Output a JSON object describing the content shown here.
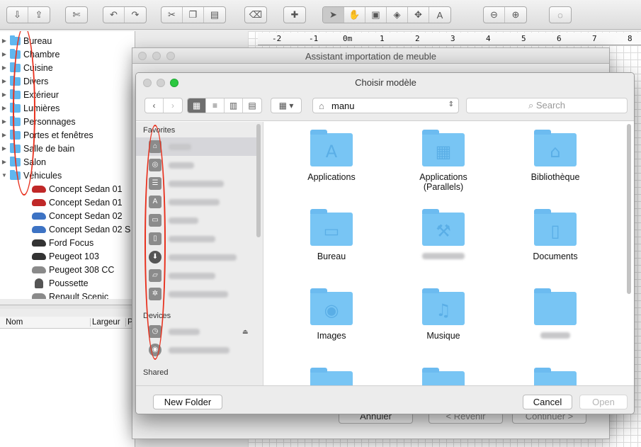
{
  "toolbar": {
    "icons": [
      "import-furniture-icon",
      "import-library-icon",
      "preferences-icon",
      "undo-icon",
      "redo-icon",
      "cut-icon",
      "copy-icon",
      "paste-icon",
      "delete-icon",
      "add-furniture-icon",
      "select-icon",
      "pan-icon",
      "create-walls-icon",
      "create-rooms-icon",
      "create-dimensions-icon",
      "create-labels-icon",
      "zoom-out-icon",
      "zoom-in-icon",
      "help-icon"
    ]
  },
  "catalog": {
    "categories": [
      "Bureau",
      "Chambre",
      "Cuisine",
      "Divers",
      "Extérieur",
      "Lumières",
      "Personnages",
      "Portes et fenêtres",
      "Salle de bain",
      "Salon",
      "Véhicules"
    ],
    "vehicles": [
      "Concept Sedan 01",
      "Concept Sedan 01",
      "Concept Sedan 02",
      "Concept Sedan 02 S",
      "Ford Focus",
      "Peugeot 103",
      "Peugeot 308 CC",
      "Poussette",
      "Renault Scenic"
    ]
  },
  "furniture_list": {
    "columns": [
      "Nom",
      "Largeur",
      "P"
    ]
  },
  "ruler": {
    "ticks": [
      "-2",
      "-1",
      "0m",
      "1",
      "2",
      "3",
      "4",
      "5",
      "6",
      "7",
      "8"
    ]
  },
  "assistant": {
    "title": "Assistant importation de meuble",
    "cancel": "Annuler",
    "back": "< Revenir",
    "next": "Continuer >"
  },
  "chooser": {
    "title": "Choisir modèle",
    "path": "manu",
    "search_placeholder": "Search",
    "sidebar": {
      "favorites_header": "Favorites",
      "devices_header": "Devices",
      "shared_header": "Shared",
      "favorite_icons": [
        "home-icon",
        "airdrop-icon",
        "all-files-icon",
        "applications-icon",
        "desktop-icon",
        "documents-icon",
        "downloads-icon",
        "folder-icon",
        "gear-icon"
      ],
      "device_icons": [
        "time-machine-icon",
        "disc-icon"
      ]
    },
    "files": [
      {
        "name": "Applications",
        "glyph": "A"
      },
      {
        "name": "Applications\n(Parallels)",
        "glyph": "▦"
      },
      {
        "name": "Bibliothèque",
        "glyph": "⌂"
      },
      {
        "name": "Bureau",
        "glyph": "▭"
      },
      {
        "name": "",
        "glyph": "⚒"
      },
      {
        "name": "Documents",
        "glyph": "▯"
      },
      {
        "name": "Images",
        "glyph": "◉"
      },
      {
        "name": "Musique",
        "glyph": "♫"
      },
      {
        "name": "",
        "glyph": ""
      }
    ],
    "new_folder": "New Folder",
    "cancel": "Cancel",
    "open": "Open"
  }
}
